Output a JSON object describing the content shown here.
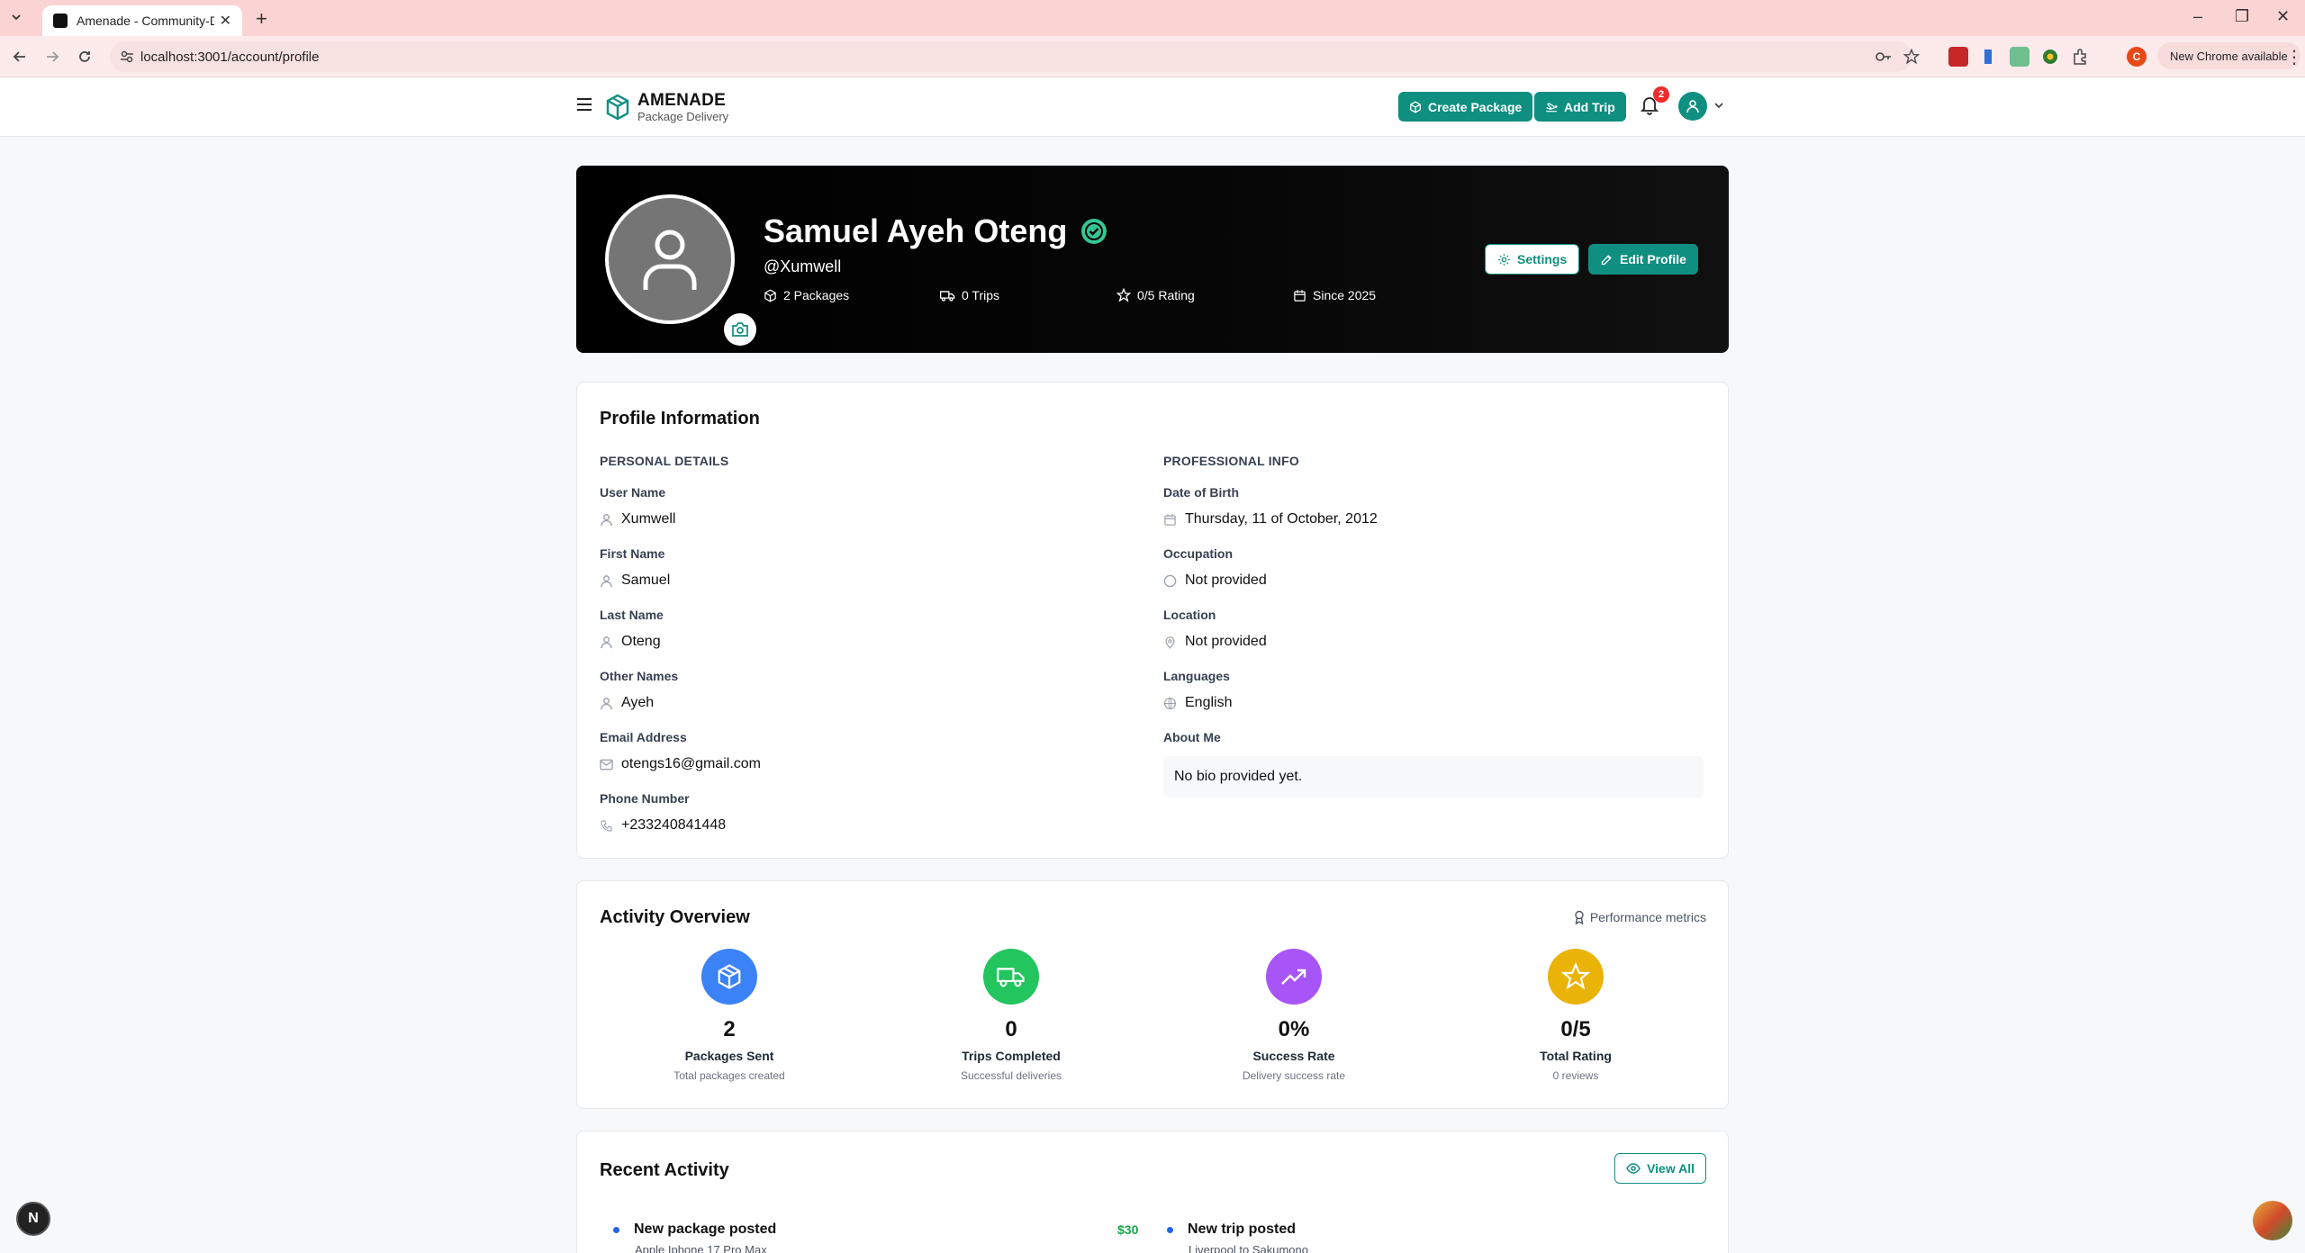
{
  "browser": {
    "tab_title": "Amenade - Community-Driven",
    "url": "localhost:3001/account/profile",
    "new_chrome_label": "New Chrome available",
    "profile_initial": "C"
  },
  "header": {
    "brand_name": "AMENADE",
    "brand_tagline": "Package Delivery",
    "create_package_label": "Create Package",
    "add_trip_label": "Add Trip",
    "notification_count": "2"
  },
  "hero": {
    "full_name": "Samuel Ayeh Oteng",
    "handle": "@Xumwell",
    "stats": {
      "packages": "2 Packages",
      "trips": "0 Trips",
      "rating": "0/5 Rating",
      "since": "Since 2025"
    },
    "settings_label": "Settings",
    "edit_profile_label": "Edit Profile"
  },
  "profile": {
    "title": "Profile Information",
    "personal_header": "PERSONAL DETAILS",
    "professional_header": "PROFESSIONAL INFO",
    "personal": [
      {
        "label": "User Name",
        "value": "Xumwell"
      },
      {
        "label": "First Name",
        "value": "Samuel"
      },
      {
        "label": "Last Name",
        "value": "Oteng"
      },
      {
        "label": "Other Names",
        "value": "Ayeh"
      },
      {
        "label": "Email Address",
        "value": "otengs16@gmail.com"
      },
      {
        "label": "Phone Number",
        "value": "+233240841448"
      }
    ],
    "professional": [
      {
        "label": "Date of Birth",
        "value": "Thursday, 11 of October, 2012"
      },
      {
        "label": "Occupation",
        "value": "Not provided"
      },
      {
        "label": "Location",
        "value": "Not provided"
      },
      {
        "label": "Languages",
        "value": "English"
      }
    ],
    "about_label": "About Me",
    "about_value": "No bio provided yet."
  },
  "activity": {
    "title": "Activity Overview",
    "performance_label": "Performance metrics",
    "metrics": [
      {
        "value": "2",
        "label": "Packages Sent",
        "sub": "Total packages created",
        "color": "#3b82f6"
      },
      {
        "value": "0",
        "label": "Trips Completed",
        "sub": "Successful deliveries",
        "color": "#22c55e"
      },
      {
        "value": "0%",
        "label": "Success Rate",
        "sub": "Delivery success rate",
        "color": "#a855f7"
      },
      {
        "value": "0/5",
        "label": "Total Rating",
        "sub": "0 reviews",
        "color": "#eab308"
      }
    ]
  },
  "recent": {
    "title": "Recent Activity",
    "view_all_label": "View All",
    "items": [
      {
        "title": "New package posted",
        "sub": "Apple Iphone 17 Pro Max",
        "amount": "$30"
      },
      {
        "title": "New trip posted",
        "sub": "Liverpool to Sakumono"
      }
    ]
  },
  "dev_indicator": "N"
}
